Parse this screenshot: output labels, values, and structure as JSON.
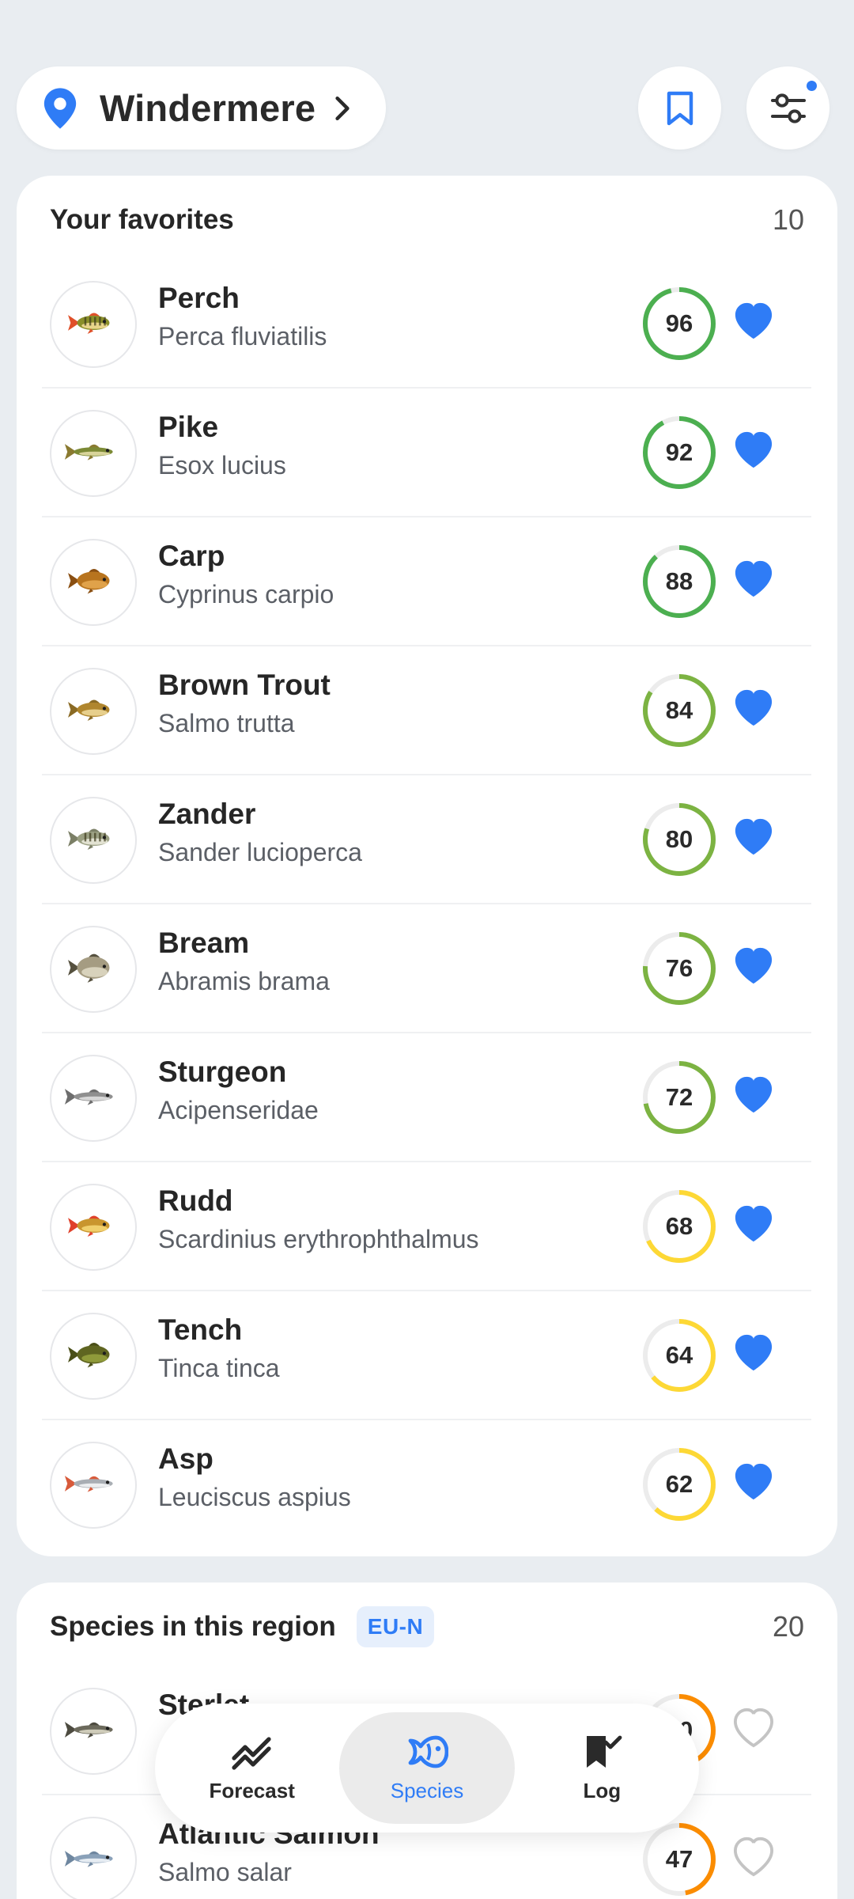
{
  "location": {
    "name": "Windermere"
  },
  "colors": {
    "accent": "#2f7cf6",
    "ring_high": "#4caf50",
    "ring_good": "#7cb342",
    "ring_mid": "#fdd835",
    "ring_low": "#fb8c00",
    "track": "#ececec"
  },
  "favorites": {
    "title": "Your favorites",
    "count": "10",
    "items": [
      {
        "name": "Perch",
        "latin": "Perca fluviatilis",
        "score": 96,
        "favorite": true,
        "icon": "perch-fish-icon"
      },
      {
        "name": "Pike",
        "latin": "Esox lucius",
        "score": 92,
        "favorite": true,
        "icon": "pike-fish-icon"
      },
      {
        "name": "Carp",
        "latin": "Cyprinus carpio",
        "score": 88,
        "favorite": true,
        "icon": "carp-fish-icon"
      },
      {
        "name": "Brown Trout",
        "latin": "Salmo trutta",
        "score": 84,
        "favorite": true,
        "icon": "trout-fish-icon"
      },
      {
        "name": "Zander",
        "latin": "Sander lucioperca",
        "score": 80,
        "favorite": true,
        "icon": "zander-fish-icon"
      },
      {
        "name": "Bream",
        "latin": "Abramis brama",
        "score": 76,
        "favorite": true,
        "icon": "bream-fish-icon"
      },
      {
        "name": "Sturgeon",
        "latin": "Acipenseridae",
        "score": 72,
        "favorite": true,
        "icon": "sturgeon-fish-icon"
      },
      {
        "name": "Rudd",
        "latin": "Scardinius erythrophthalmus",
        "score": 68,
        "favorite": true,
        "icon": "rudd-fish-icon"
      },
      {
        "name": "Tench",
        "latin": "Tinca tinca",
        "score": 64,
        "favorite": true,
        "icon": "tench-fish-icon"
      },
      {
        "name": "Asp",
        "latin": "Leuciscus aspius",
        "score": 62,
        "favorite": true,
        "icon": "asp-fish-icon"
      }
    ]
  },
  "region": {
    "title": "Species in this region",
    "badge": "EU-N",
    "count": "20",
    "items": [
      {
        "name": "Sterlet",
        "latin": "",
        "score": 50,
        "favorite": false,
        "icon": "sterlet-fish-icon"
      },
      {
        "name": "Atlantic Salmon",
        "latin": "Salmo salar",
        "score": 47,
        "favorite": false,
        "icon": "salmon-fish-icon"
      }
    ]
  },
  "nav": {
    "items": [
      {
        "label": "Forecast",
        "icon": "chart-trend-icon",
        "active": false
      },
      {
        "label": "Species",
        "icon": "fish-icon",
        "active": true
      },
      {
        "label": "Log",
        "icon": "bookmark-check-icon",
        "active": false
      }
    ]
  }
}
